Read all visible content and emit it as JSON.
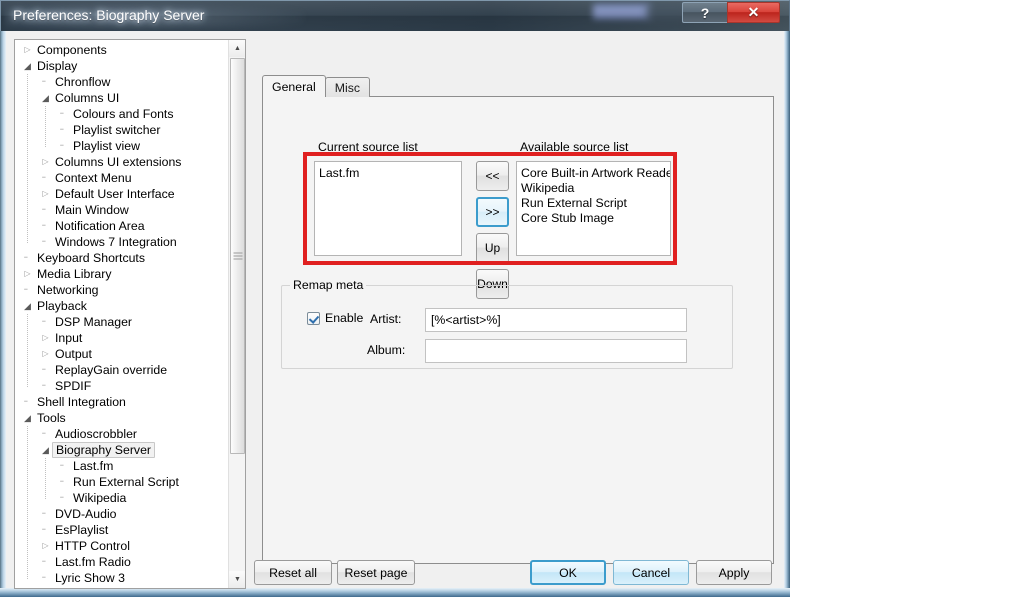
{
  "window": {
    "title": "Preferences: Biography Server",
    "help_button": "?",
    "close_button": "✕"
  },
  "tree": {
    "items": [
      {
        "label": "Components",
        "depth": 0,
        "state": "collapsed"
      },
      {
        "label": "Display",
        "depth": 0,
        "state": "expanded"
      },
      {
        "label": "Chronflow",
        "depth": 1,
        "state": "leaf"
      },
      {
        "label": "Columns UI",
        "depth": 1,
        "state": "expanded"
      },
      {
        "label": "Colours and Fonts",
        "depth": 2,
        "state": "leaf"
      },
      {
        "label": "Playlist switcher",
        "depth": 2,
        "state": "leaf"
      },
      {
        "label": "Playlist view",
        "depth": 2,
        "state": "leaf"
      },
      {
        "label": "Columns UI extensions",
        "depth": 1,
        "state": "collapsed"
      },
      {
        "label": "Context Menu",
        "depth": 1,
        "state": "leaf"
      },
      {
        "label": "Default User Interface",
        "depth": 1,
        "state": "collapsed"
      },
      {
        "label": "Main Window",
        "depth": 1,
        "state": "leaf"
      },
      {
        "label": "Notification Area",
        "depth": 1,
        "state": "leaf"
      },
      {
        "label": "Windows 7 Integration",
        "depth": 1,
        "state": "leaf"
      },
      {
        "label": "Keyboard Shortcuts",
        "depth": 0,
        "state": "leaf"
      },
      {
        "label": "Media Library",
        "depth": 0,
        "state": "collapsed"
      },
      {
        "label": "Networking",
        "depth": 0,
        "state": "leaf"
      },
      {
        "label": "Playback",
        "depth": 0,
        "state": "expanded"
      },
      {
        "label": "DSP Manager",
        "depth": 1,
        "state": "leaf"
      },
      {
        "label": "Input",
        "depth": 1,
        "state": "collapsed"
      },
      {
        "label": "Output",
        "depth": 1,
        "state": "collapsed"
      },
      {
        "label": "ReplayGain override",
        "depth": 1,
        "state": "leaf"
      },
      {
        "label": "SPDIF",
        "depth": 1,
        "state": "leaf"
      },
      {
        "label": "Shell Integration",
        "depth": 0,
        "state": "leaf"
      },
      {
        "label": "Tools",
        "depth": 0,
        "state": "expanded"
      },
      {
        "label": "Audioscrobbler",
        "depth": 1,
        "state": "leaf"
      },
      {
        "label": "Biography Server",
        "depth": 1,
        "state": "expanded",
        "selected": true
      },
      {
        "label": "Last.fm",
        "depth": 2,
        "state": "leaf"
      },
      {
        "label": "Run External Script",
        "depth": 2,
        "state": "leaf"
      },
      {
        "label": "Wikipedia",
        "depth": 2,
        "state": "leaf"
      },
      {
        "label": "DVD-Audio",
        "depth": 1,
        "state": "leaf"
      },
      {
        "label": "EsPlaylist",
        "depth": 1,
        "state": "leaf"
      },
      {
        "label": "HTTP Control",
        "depth": 1,
        "state": "collapsed"
      },
      {
        "label": "Last.fm Radio",
        "depth": 1,
        "state": "leaf"
      },
      {
        "label": "Lyric Show 3",
        "depth": 1,
        "state": "leaf"
      }
    ],
    "glyphs": {
      "collapsed": "▷",
      "expanded": "◢",
      "leaf": "╴",
      "scroll_up": "▲",
      "scroll_down": "▼"
    }
  },
  "tabs": [
    {
      "label": "General",
      "active": true
    },
    {
      "label": "Misc",
      "active": false
    }
  ],
  "general": {
    "current_list_label": "Current source list",
    "available_list_label": "Available source list",
    "current_sources": [
      "Last.fm"
    ],
    "available_sources": [
      "Core Built-in Artwork Reader",
      "Wikipedia",
      "Run External Script",
      "Core Stub Image"
    ],
    "transfer_buttons": [
      {
        "label": "<<",
        "name": "move-left-button",
        "focused": false
      },
      {
        "label": ">>",
        "name": "move-right-button",
        "focused": true
      },
      {
        "label": "Up",
        "name": "move-up-button",
        "focused": false
      },
      {
        "label": "Down",
        "name": "move-down-button",
        "focused": false
      }
    ],
    "highlight_color": "#e02020",
    "remap": {
      "group_title": "Remap meta",
      "enable_label": "Enable",
      "enabled": true,
      "artist_label": "Artist:",
      "artist_value": "[%<artist>%]",
      "album_label": "Album:",
      "album_value": ""
    }
  },
  "footer": {
    "reset_all": "Reset all",
    "reset_page": "Reset page",
    "ok": "OK",
    "cancel": "Cancel",
    "apply": "Apply"
  }
}
